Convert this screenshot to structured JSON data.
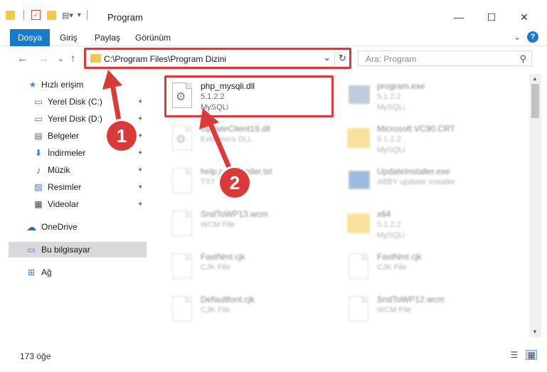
{
  "window": {
    "title": "Program",
    "minimize": "—",
    "maximize": "☐",
    "close": "✕"
  },
  "ribbon": {
    "tabs": [
      "Dosya",
      "Giriş",
      "Paylaş",
      "Görünüm"
    ],
    "collapse": "⌄",
    "help": "?"
  },
  "address": {
    "path": "C:\\Program Files\\Program Dizini",
    "dropdown": "⌄",
    "refresh": "↻"
  },
  "search": {
    "placeholder": "Ara: Program"
  },
  "nav": {
    "back": "←",
    "forward": "→",
    "recent": "⌄",
    "up": "↑"
  },
  "sidebar": {
    "items": [
      {
        "label": "Hızlı erişim",
        "icon": "star-icon",
        "glyph": "★"
      },
      {
        "label": "Yerel Disk (C:)",
        "icon": "drive-icon",
        "glyph": "▭"
      },
      {
        "label": "Yerel Disk (D:)",
        "icon": "drive-icon",
        "glyph": "▭"
      },
      {
        "label": "Belgeler",
        "icon": "documents-icon",
        "glyph": "▤"
      },
      {
        "label": "İndirmeler",
        "icon": "download-icon",
        "glyph": "⬇"
      },
      {
        "label": "Müzik",
        "icon": "music-icon",
        "glyph": "♪"
      },
      {
        "label": "Resimler",
        "icon": "pictures-icon",
        "glyph": "▨"
      },
      {
        "label": "Videolar",
        "icon": "videos-icon",
        "glyph": "▦"
      },
      {
        "label": "OneDrive",
        "icon": "cloud-icon",
        "glyph": "☁"
      },
      {
        "label": "Bu bilgisayar",
        "icon": "computer-icon",
        "glyph": "▭"
      },
      {
        "label": "Ağ",
        "icon": "network-icon",
        "glyph": "⊞"
      }
    ],
    "pin_glyph": "📌"
  },
  "files": [
    {
      "name": "php_mysqli.dll",
      "line1": "5.1.2.2",
      "line2": "MySQLi"
    },
    {
      "name": "program.exe",
      "line1": "5.1.2.2",
      "line2": "MySQLi"
    },
    {
      "name": "UpdateClient19.dll",
      "line1": "Extensora DLL",
      "line2": ""
    },
    {
      "name": "Microsoft.VC90.CRT",
      "line1": "5.1.2.2",
      "line2": "MySQLi"
    },
    {
      "name": "help.pdf.Reader.txt",
      "line1": "TXT",
      "line2": ""
    },
    {
      "name": "UpdateInstaller.exe",
      "line1": "ABBY updater installer",
      "line2": ""
    },
    {
      "name": "SndToWP13.wcm",
      "line1": "WCM File",
      "line2": ""
    },
    {
      "name": "x64",
      "line1": "5.1.2.2",
      "line2": "MySQLi"
    },
    {
      "name": "FastNml.cjk",
      "line1": "CJK File",
      "line2": ""
    },
    {
      "name": "FastNml.cjk",
      "line1": "CJK File",
      "line2": ""
    },
    {
      "name": "Defaultfont.cjk",
      "line1": "CJK File",
      "line2": ""
    },
    {
      "name": "SndToWP12.wcm",
      "line1": "WCM File",
      "line2": ""
    }
  ],
  "status": {
    "count": "173 öğe"
  },
  "callouts": [
    "1",
    "2"
  ],
  "colors": {
    "accent": "#1979ca",
    "highlight": "#d93a3a"
  }
}
